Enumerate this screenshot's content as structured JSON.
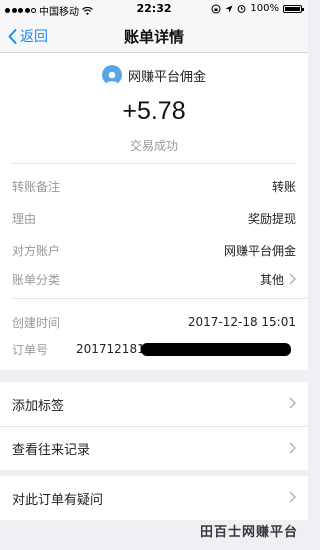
{
  "status_bar": {
    "carrier": "中国移动",
    "time": "22:32",
    "battery": "100%"
  },
  "nav": {
    "back_label": "返回",
    "title": "账单详情"
  },
  "header": {
    "payee": "网赚平台佣金",
    "amount": "+5.78",
    "status": "交易成功"
  },
  "details": [
    {
      "key": "转账备注",
      "value": "转账"
    },
    {
      "key": "理由",
      "value": "奖励提现"
    },
    {
      "key": "对方账户",
      "value": "网赚平台佣金"
    },
    {
      "key": "账单分类",
      "value": "其他"
    }
  ],
  "meta": {
    "created_label": "创建时间",
    "created_value": "2017-12-18 15:01",
    "order_label": "订单号",
    "order_value": "201712181"
  },
  "actions": {
    "add_tag": "添加标签",
    "history": "查看往来记录",
    "question": "对此订单有疑问"
  },
  "watermark": "田百士网赚平台",
  "colors": {
    "accent": "#1a8cf0",
    "background": "#efeff4",
    "muted": "#999999"
  }
}
